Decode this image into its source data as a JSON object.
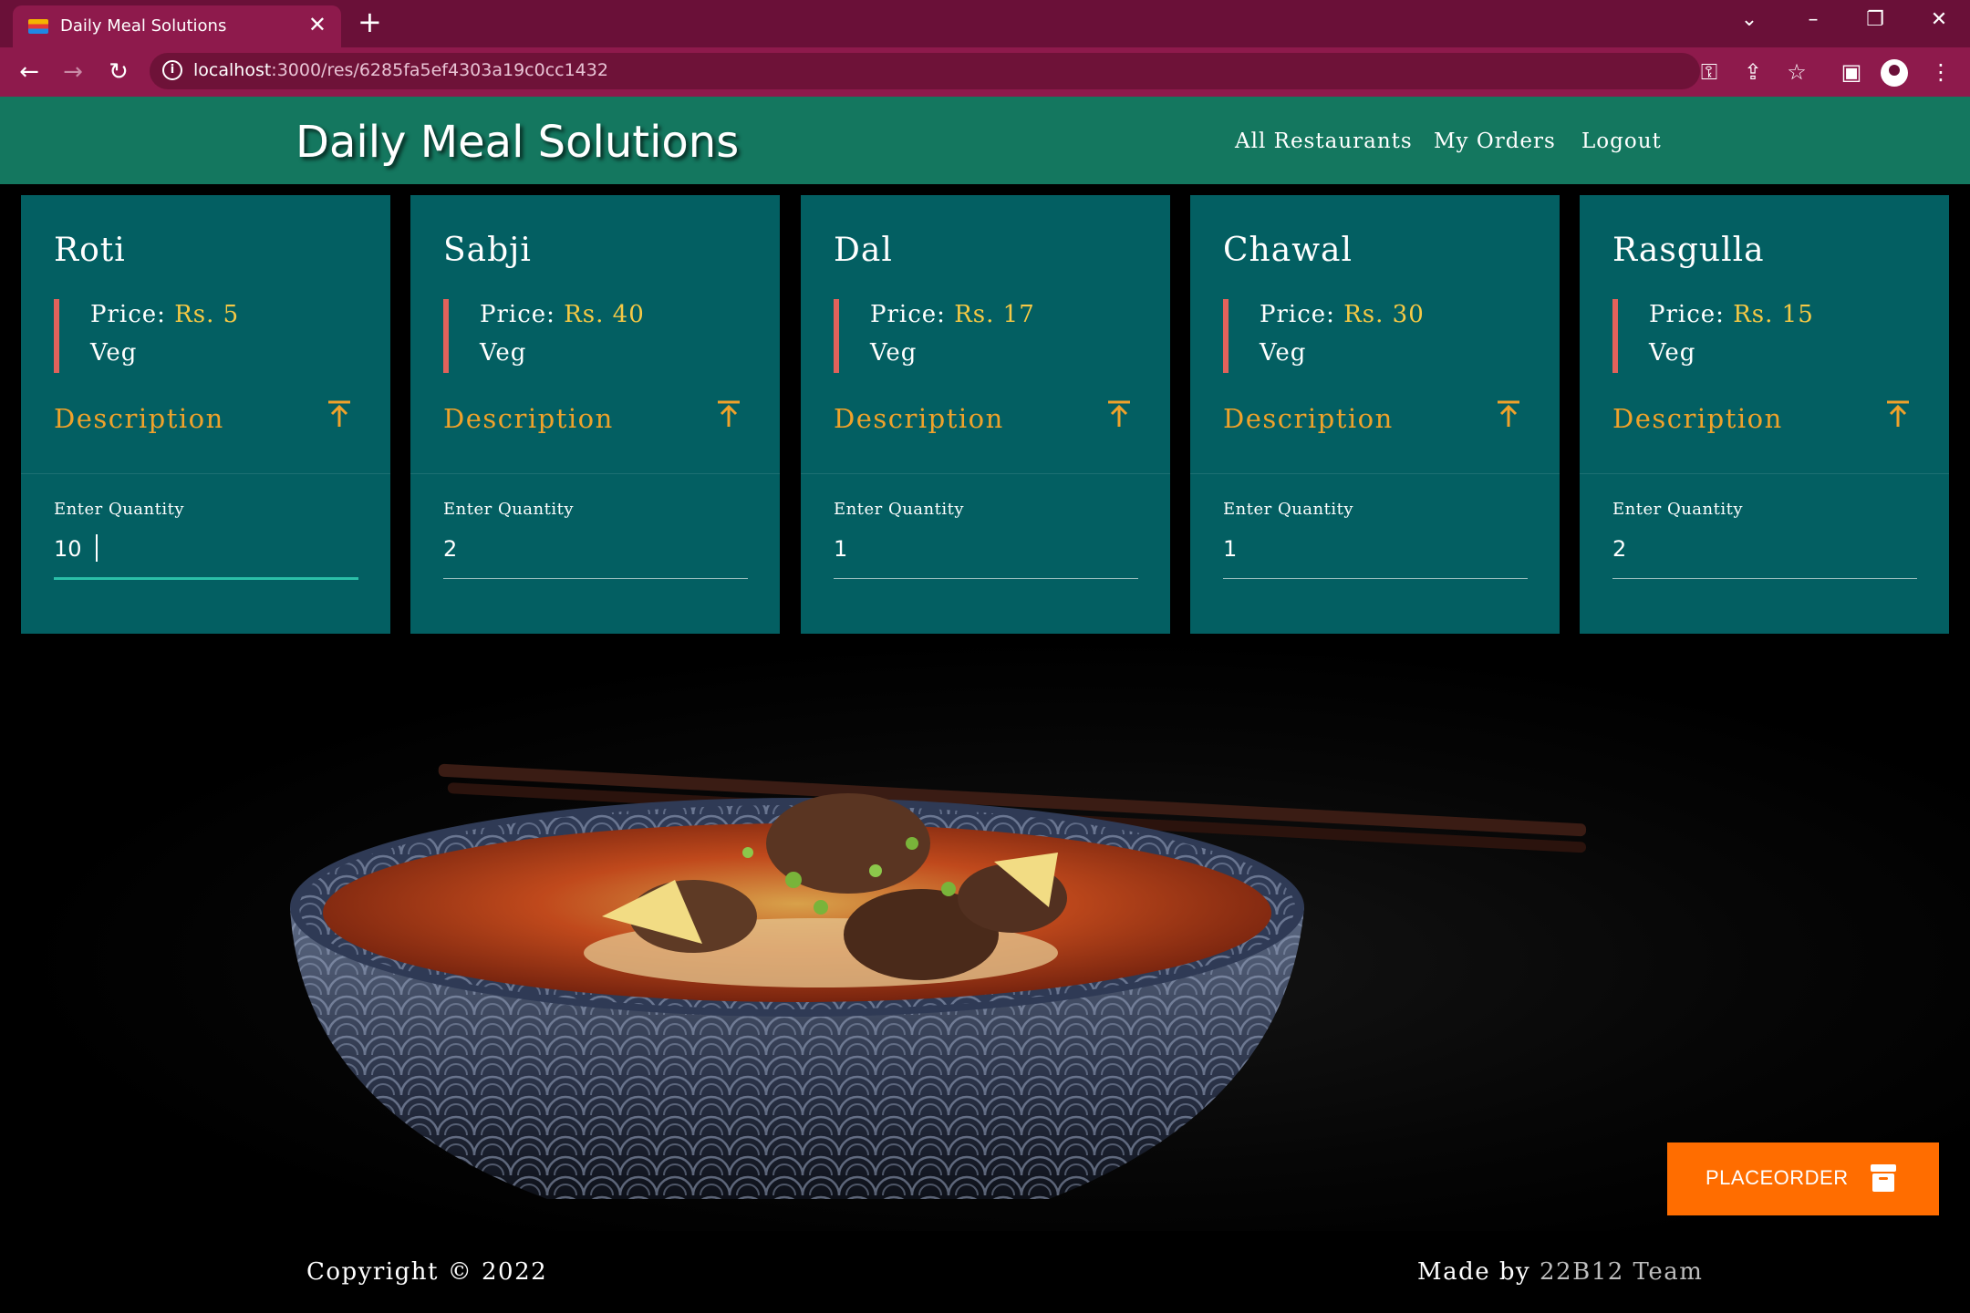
{
  "browser": {
    "tab_title": "Daily Meal Solutions",
    "url_host": "localhost",
    "url_path": ":3000/res/6285fa5ef4303a19c0cc1432"
  },
  "header": {
    "brand": "Daily Meal Solutions",
    "nav": {
      "all_restaurants": "All Restaurants",
      "my_orders": "My Orders",
      "logout": "Logout"
    }
  },
  "meals": [
    {
      "name": "Roti",
      "price_label": "Price:",
      "price": "Rs. 5",
      "type": "Veg",
      "description_label": "Description",
      "quantity_label": "Enter Quantity",
      "quantity": "10"
    },
    {
      "name": "Sabji",
      "price_label": "Price:",
      "price": "Rs. 40",
      "type": "Veg",
      "description_label": "Description",
      "quantity_label": "Enter Quantity",
      "quantity": "2"
    },
    {
      "name": "Dal",
      "price_label": "Price:",
      "price": "Rs. 17",
      "type": "Veg",
      "description_label": "Description",
      "quantity_label": "Enter Quantity",
      "quantity": "1"
    },
    {
      "name": "Chawal",
      "price_label": "Price:",
      "price": "Rs. 30",
      "type": "Veg",
      "description_label": "Description",
      "quantity_label": "Enter Quantity",
      "quantity": "1"
    },
    {
      "name": "Rasgulla",
      "price_label": "Price:",
      "price": "Rs. 15",
      "type": "Veg",
      "description_label": "Description",
      "quantity_label": "Enter Quantity",
      "quantity": "2"
    }
  ],
  "place_order": {
    "label": "PLACEORDER",
    "icon": "archive-icon"
  },
  "footer": {
    "copyright": "Copyright © 2022",
    "made_by_prefix": "Made by ",
    "team": "22B12 Team"
  },
  "colors": {
    "browser_frame": "#6a1038",
    "header_bg": "#14775f",
    "card_bg": "#035f62",
    "price_accent": "#f6c945",
    "description_accent": "#f0a22a",
    "card_bar": "#e2625b",
    "place_order_bg": "#ff6d00"
  }
}
